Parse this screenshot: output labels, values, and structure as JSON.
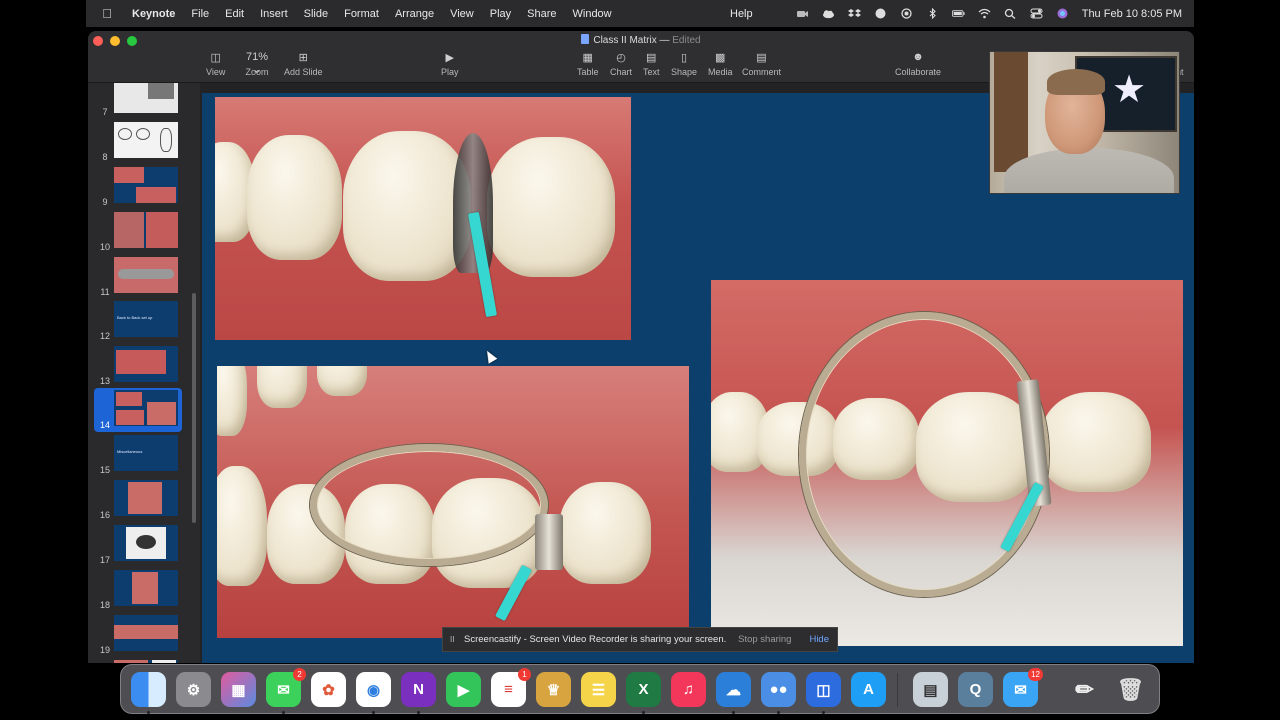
{
  "menubar": {
    "app_name": "Keynote",
    "items": [
      "File",
      "Edit",
      "Insert",
      "Slide",
      "Format",
      "Arrange",
      "View",
      "Play",
      "Share",
      "Window"
    ],
    "help": "Help",
    "clock": "Thu Feb 10  8:05 PM"
  },
  "window": {
    "title": "Class II Matrix",
    "title_separator": "—",
    "status": "Edited"
  },
  "toolbar": {
    "view_label": "View",
    "zoom_value": "71%",
    "zoom_label": "Zoom",
    "add_slide_label": "Add Slide",
    "play_label": "Play",
    "table_label": "Table",
    "chart_label": "Chart",
    "text_label": "Text",
    "shape_label": "Shape",
    "media_label": "Media",
    "comment_label": "Comment",
    "collaborate_label": "Collaborate",
    "format_label_partial": "nt"
  },
  "slides": [
    {
      "number": "7"
    },
    {
      "number": "8"
    },
    {
      "number": "9"
    },
    {
      "number": "10"
    },
    {
      "number": "11"
    },
    {
      "number": "12",
      "text": "Back to Back set up"
    },
    {
      "number": "13"
    },
    {
      "number": "14",
      "selected": true
    },
    {
      "number": "15",
      "text": "Miscellaneous"
    },
    {
      "number": "16"
    },
    {
      "number": "17"
    },
    {
      "number": "18"
    },
    {
      "number": "19"
    }
  ],
  "sharing_bar": {
    "pause_glyph": "II",
    "message": "Screencastify - Screen Video Recorder is sharing your screen.",
    "stop_label": "Stop sharing",
    "hide_label": "Hide"
  },
  "dock": {
    "messages_badge": "2",
    "reminders_badge": "1",
    "mail_badge": "12"
  },
  "colors": {
    "slide_background": "#0c3f6c",
    "selection": "#1d64d6",
    "wedge": "#35d7d0"
  }
}
